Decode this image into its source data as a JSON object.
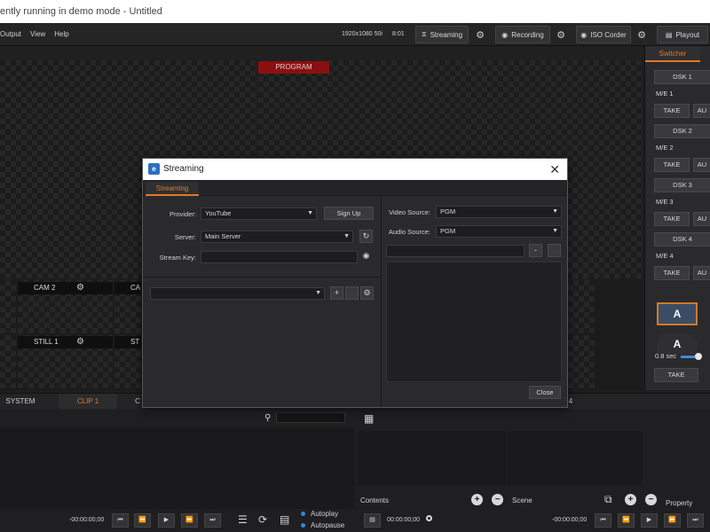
{
  "window": {
    "title": "ently running in demo mode - Untitled"
  },
  "menu": {
    "items": [
      "Output",
      "View",
      "Help"
    ]
  },
  "toolbar": {
    "resolution": "1920x1080 50i",
    "clock": "8:01",
    "streaming_label": "Streaming",
    "recording_label": "Recording",
    "iso_label": "ISO Corder",
    "playout_label": "Playout"
  },
  "preview": {
    "program_label": "PROGRAM"
  },
  "inputs": [
    {
      "label": "CAM 2"
    },
    {
      "label": "CA"
    },
    {
      "label": "STILL 1"
    },
    {
      "label": "ST"
    }
  ],
  "switcher": {
    "tab": "Switcher",
    "rows": [
      {
        "dsk": "DSK 1",
        "me": "M/E 1",
        "take": "TAKE",
        "auto": "AU"
      },
      {
        "dsk": "DSK 2",
        "me": "M/E 2",
        "take": "TAKE",
        "auto": "AU"
      },
      {
        "dsk": "DSK 3",
        "me": "M/E 3",
        "take": "TAKE",
        "auto": "AU"
      },
      {
        "dsk": "DSK 4",
        "me": "M/E 4",
        "take": "TAKE",
        "auto": "AU"
      }
    ],
    "a_label": "A",
    "a2_label": "A",
    "duration": "0.8 sec",
    "take": "TAKE"
  },
  "bottom_tabs": [
    {
      "label": "SYSTEM",
      "active": false
    },
    {
      "label": "CLIP 1",
      "active": true
    },
    {
      "label": "C",
      "active": false
    },
    {
      "label": "4",
      "active": false
    }
  ],
  "lower": {
    "time_left": "-00:00:00;00",
    "time_mid": "00:00:00;00",
    "time_right": "-00:00:00;00",
    "autoplay": "Autoplay",
    "autopause": "Autopause",
    "contents": "Contents",
    "scene": "Scene",
    "property": "Property"
  },
  "modal": {
    "title": "Streaming",
    "tab": "Streaming",
    "provider_label": "Provider:",
    "provider_value": "YouTube",
    "signup": "Sign Up",
    "server_label": "Server:",
    "server_value": "Main Server",
    "streamkey_label": "Stream Key:",
    "video_source_label": "Video Source:",
    "video_source_value": "PGM",
    "audio_source_label": "Audio Source:",
    "audio_source_value": "PGM",
    "close": "Close",
    "plus": "+",
    "minus": "-"
  }
}
